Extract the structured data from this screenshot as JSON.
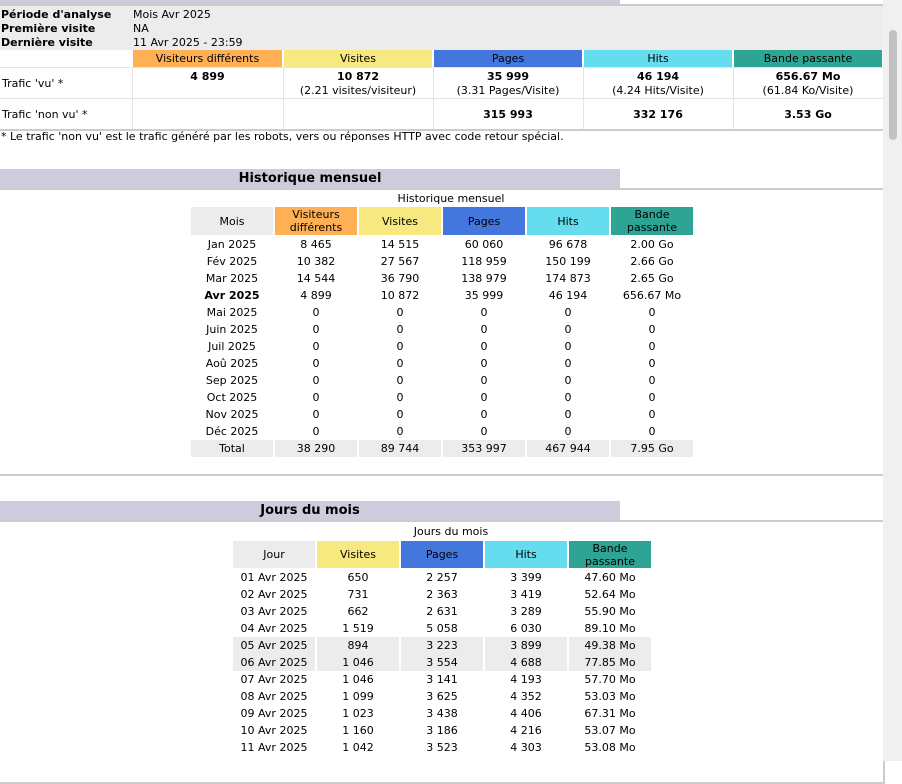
{
  "summary": {
    "lines": [
      {
        "label": "Période d'analyse",
        "value": "Mois Avr 2025"
      },
      {
        "label": "Première visite",
        "value": "NA"
      },
      {
        "label": "Dernière visite",
        "value": "11 Avr 2025 - 23:59"
      }
    ],
    "headers": [
      "Visiteurs différents",
      "Visites",
      "Pages",
      "Hits",
      "Bande passante"
    ],
    "seen": {
      "label": "Trafic 'vu' *",
      "values": [
        "4 899",
        "10 872",
        "35 999",
        "46 194",
        "656.67 Mo"
      ],
      "subs": [
        "",
        "(2.21 visites/visiteur)",
        "(3.31 Pages/Visite)",
        "(4.24 Hits/Visite)",
        "(61.84 Ko/Visite)"
      ]
    },
    "unseen": {
      "label": "Trafic 'non vu' *",
      "values": [
        "",
        "",
        "315 993",
        "332 176",
        "3.53 Go"
      ]
    },
    "footnote": "* Le trafic 'non vu' est le trafic généré par les robots, vers ou réponses HTTP avec code retour spécial."
  },
  "monthly": {
    "title": "Historique mensuel",
    "caption": "Historique mensuel",
    "headers": [
      "Mois",
      "Visiteurs différents",
      "Visites",
      "Pages",
      "Hits",
      "Bande passante"
    ],
    "rows": [
      [
        "Jan 2025",
        "8 465",
        "14 515",
        "60 060",
        "96 678",
        "2.00 Go"
      ],
      [
        "Fév 2025",
        "10 382",
        "27 567",
        "118 959",
        "150 199",
        "2.66 Go"
      ],
      [
        "Mar 2025",
        "14 544",
        "36 790",
        "138 979",
        "174 873",
        "2.65 Go"
      ],
      [
        "Avr 2025",
        "4 899",
        "10 872",
        "35 999",
        "46 194",
        "656.67 Mo"
      ],
      [
        "Mai 2025",
        "0",
        "0",
        "0",
        "0",
        "0"
      ],
      [
        "Juin 2025",
        "0",
        "0",
        "0",
        "0",
        "0"
      ],
      [
        "Juil 2025",
        "0",
        "0",
        "0",
        "0",
        "0"
      ],
      [
        "Aoû 2025",
        "0",
        "0",
        "0",
        "0",
        "0"
      ],
      [
        "Sep 2025",
        "0",
        "0",
        "0",
        "0",
        "0"
      ],
      [
        "Oct 2025",
        "0",
        "0",
        "0",
        "0",
        "0"
      ],
      [
        "Nov 2025",
        "0",
        "0",
        "0",
        "0",
        "0"
      ],
      [
        "Déc 2025",
        "0",
        "0",
        "0",
        "0",
        "0"
      ]
    ],
    "current_row": 3,
    "total": [
      "Total",
      "38 290",
      "89 744",
      "353 997",
      "467 944",
      "7.95 Go"
    ]
  },
  "daily": {
    "title": "Jours du mois",
    "caption": "Jours du mois",
    "headers": [
      "Jour",
      "Visites",
      "Pages",
      "Hits",
      "Bande passante"
    ],
    "rows": [
      [
        "01 Avr 2025",
        "650",
        "2 257",
        "3 399",
        "47.60 Mo"
      ],
      [
        "02 Avr 2025",
        "731",
        "2 363",
        "3 419",
        "52.64 Mo"
      ],
      [
        "03 Avr 2025",
        "662",
        "2 631",
        "3 289",
        "55.90 Mo"
      ],
      [
        "04 Avr 2025",
        "1 519",
        "5 058",
        "6 030",
        "89.10 Mo"
      ],
      [
        "05 Avr 2025",
        "894",
        "3 223",
        "3 899",
        "49.38 Mo"
      ],
      [
        "06 Avr 2025",
        "1 046",
        "3 554",
        "4 688",
        "77.85 Mo"
      ],
      [
        "07 Avr 2025",
        "1 046",
        "3 141",
        "4 193",
        "57.70 Mo"
      ],
      [
        "08 Avr 2025",
        "1 099",
        "3 625",
        "4 352",
        "53.03 Mo"
      ],
      [
        "09 Avr 2025",
        "1 023",
        "3 438",
        "4 406",
        "67.31 Mo"
      ],
      [
        "10 Avr 2025",
        "1 160",
        "3 186",
        "4 216",
        "53.07 Mo"
      ],
      [
        "11 Avr 2025",
        "1 042",
        "3 523",
        "4 303",
        "53.08 Mo"
      ]
    ],
    "weekend_rows": [
      4,
      5
    ]
  }
}
